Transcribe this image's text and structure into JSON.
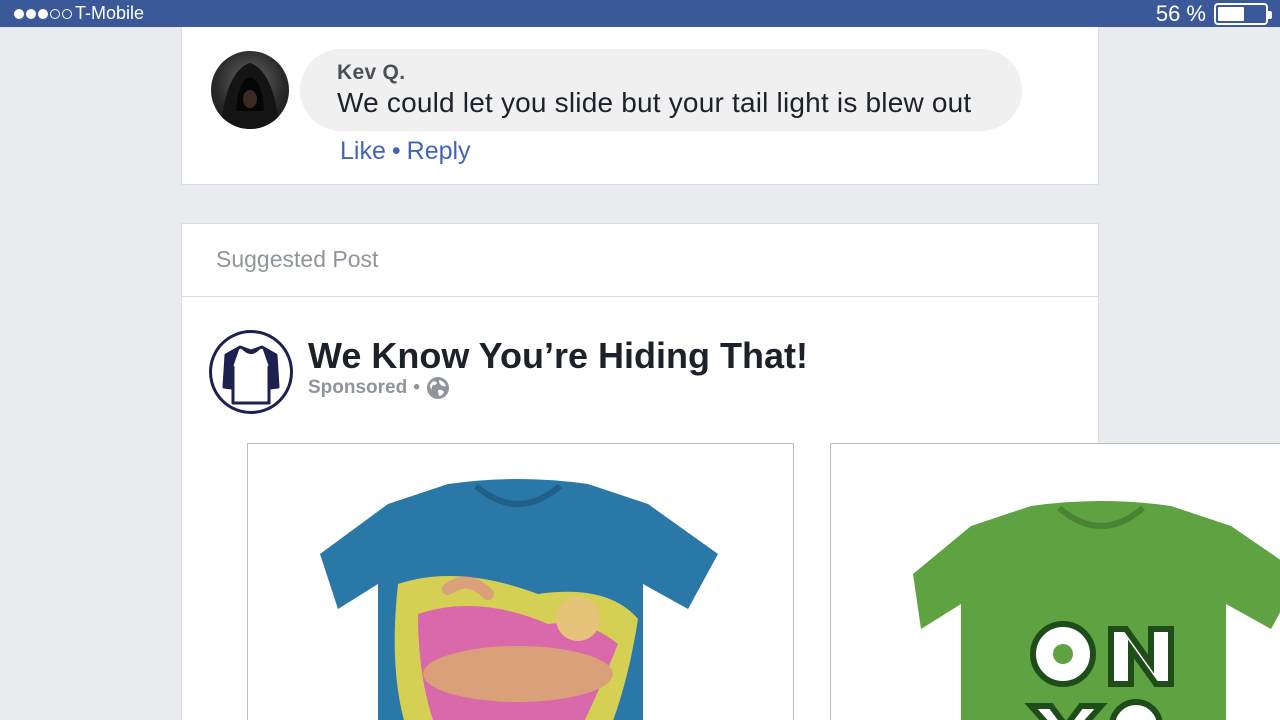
{
  "status_bar": {
    "carrier": "T-Mobile",
    "signal_dots_filled": 3,
    "signal_dots_total": 5,
    "battery_percent": "56 %",
    "battery_level": 0.56
  },
  "comment": {
    "author": "Kev Q.",
    "text": "We could let you slide but your tail light is blew out",
    "like_label": "Like",
    "separator": "•",
    "reply_label": "Reply"
  },
  "suggested_post": {
    "label": "Suggested Post",
    "page_name": "We Know You’re Hiding That!",
    "sponsored_label": "Sponsored",
    "meta_separator": "•",
    "carousel": [
      {
        "name": "blue-tshirt",
        "color": "#2a78a8"
      },
      {
        "name": "green-tshirt",
        "color": "#5fa241"
      }
    ]
  },
  "colors": {
    "brand_blue": "#3b5998",
    "link_blue": "#4267b2",
    "background": "#e9ebee"
  }
}
